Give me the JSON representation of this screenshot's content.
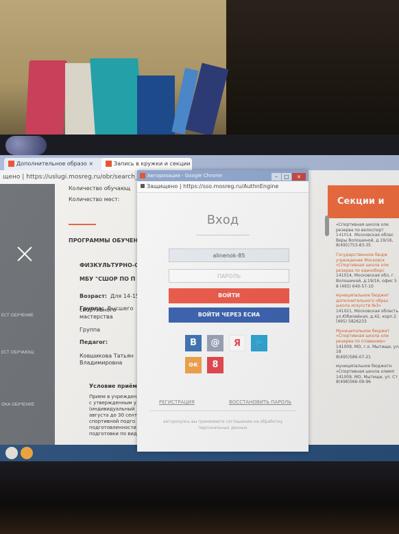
{
  "browser": {
    "tabs": [
      {
        "label": "Дополнительное образо"
      },
      {
        "label": "Запись в кружки и секции"
      }
    ],
    "url_left": "щено | https://uslugi.mosreg.ru/obr/search_se"
  },
  "page": {
    "lines": [
      "Количество обучающ",
      "Количество мест:",
      "ПРОГРАММЫ ОБУЧЕН",
      "ФИЗКУЛЬТУРНО-СП",
      "МБУ \"СШОР ПО П",
      "Возраст:",
      "Для 14-15",
      "Группа:",
      "Высшего",
      "спортивного",
      "мастерства",
      "Группа",
      "Педагог:",
      "Ковшикова Татьян",
      "Владимировна",
      "Условие приёма",
      "Прием в учрежден",
      "с утвержденным у",
      "(индивидуальный",
      "августа до 30 сент",
      "спортивной подго",
      "подготовленности",
      "подготовки по вид"
    ],
    "right_banner": "Секции и кру",
    "right_text": [
      "«Спортивная школа оли",
      "резерва по велоспорт",
      "141014, Московская облас",
      "Веры Волошиной, д.19/16,",
      "8(495)753-83-35",
      "Государственное бюдж",
      "учреждение Московск",
      "«Спортивная школа оли",
      "резерва по единоборс",
      "141014, Московская обл, г.",
      "Волошиной, д.19/16, офис 5",
      "8 (495) 640-57-10",
      "муниципальное бюджет",
      "дополнительного образ",
      "школа искусств №3»",
      "141021, Московская область",
      "ул.Юбилейная, д.42, корп.2",
      "(495) 5826233",
      "Муниципальное бюджет",
      "«Спортивная школа оли",
      "резерва по плаванию»",
      "141009, МО, г.о. Мытищи, ул.",
      "18",
      "8(495)586-07-21",
      "муниципальное бюджетн",
      "«Спортивная школа олимп",
      "141009, МО, Мытищи, ул. Ст",
      "8(498)566-09-96"
    ]
  },
  "popup": {
    "title": "Авторизация - Google Chrome",
    "secure_label": "Защищено",
    "url": "https://sso.mosreg.ru/AuthnEngine",
    "heading": "Вход",
    "login_value": "alinenok-85",
    "password_placeholder": "ПАРОЛЬ",
    "login_button": "ВОЙТИ",
    "esia_button": "ВОЙТИ ЧЕРЕЗ ЕСИА",
    "social": [
      "В",
      "@",
      "Я",
      "🐦",
      "ок",
      "8"
    ],
    "register_link": "РЕГИСТРАЦИЯ",
    "restore_link": "ВОССТАНОВИТЬ ПАРОЛЬ",
    "footer": "авторизуясь вы принимаете соглашение на обработку персональных данных"
  },
  "colors": {
    "login_button": "#ef5a4a",
    "esia_button": "#3b62b0",
    "vk": "#3f74b5",
    "mail": "#9aa4b8",
    "yandex": "#ffffff",
    "twitter": "#2da7d4",
    "ok": "#f2a34a",
    "gplus": "#e5484e"
  }
}
